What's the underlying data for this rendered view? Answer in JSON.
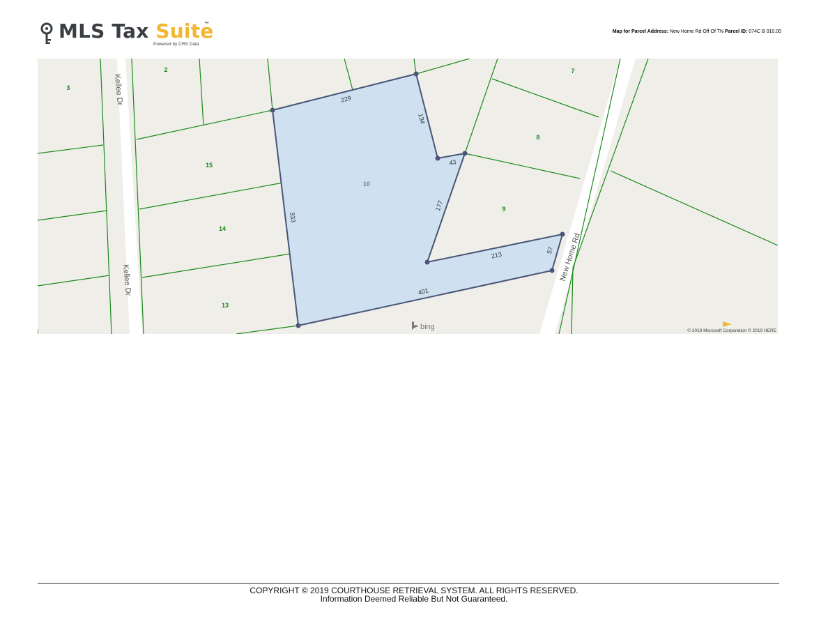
{
  "logo": {
    "word_main": "MLS Tax ",
    "word_accent": "Suite",
    "trademark": "™",
    "tagline": "Powered by CRS Data",
    "accent_color": "#f2b632"
  },
  "header": {
    "address_label": "Map for Parcel Address:",
    "address_value": "New Home Rd Off Of TN",
    "parcel_label": "Parcel ID:",
    "parcel_value": "074C B 010.00"
  },
  "map": {
    "selected_parcel": "10",
    "selected_fill": "#cfe0f0",
    "parcel_line_color": "#1a8a1a",
    "parcel_labels": [
      "3",
      "2",
      "15",
      "14",
      "13",
      "7",
      "8",
      "9"
    ],
    "edge_lengths": [
      "229",
      "134",
      "43",
      "177",
      "213",
      "57",
      "401",
      "333"
    ],
    "streets": [
      "Kellee Dr",
      "Kellee Dr",
      "New Home Rd"
    ],
    "provider": "bing",
    "attribution": "© 2019 Microsoft Corporation © 2019 HERE"
  },
  "footer": {
    "copyright": "COPYRIGHT © 2019 COURTHOUSE RETRIEVAL SYSTEM. ALL RIGHTS RESERVED.",
    "disclaimer": "Information Deemed Reliable But Not Guaranteed."
  }
}
